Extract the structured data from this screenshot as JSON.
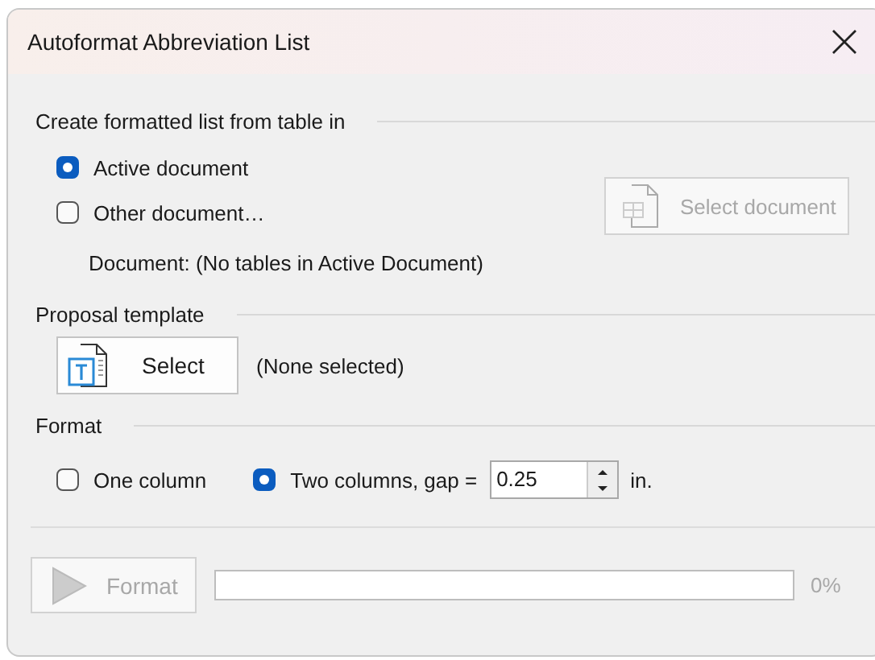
{
  "window": {
    "title": "Autoformat Abbreviation List"
  },
  "source": {
    "heading": "Create formatted list from table in",
    "options": [
      {
        "label": "Active document",
        "selected": true
      },
      {
        "label": "Other document…",
        "selected": false
      }
    ],
    "select_button": {
      "label": "Select document",
      "disabled": true
    },
    "document_line": "Document: (No tables in Active Document)"
  },
  "template": {
    "heading": "Proposal template",
    "button": "Select",
    "status": "(None selected)"
  },
  "format": {
    "heading": "Format",
    "options": [
      {
        "label": "One column",
        "selected": false
      },
      {
        "label": "Two columns, gap =",
        "selected": true
      }
    ],
    "gap": "0.25",
    "unit": "in."
  },
  "footer": {
    "button": {
      "label": "Format",
      "disabled": true
    },
    "progress": {
      "level": 0
    },
    "reading": "0%"
  }
}
